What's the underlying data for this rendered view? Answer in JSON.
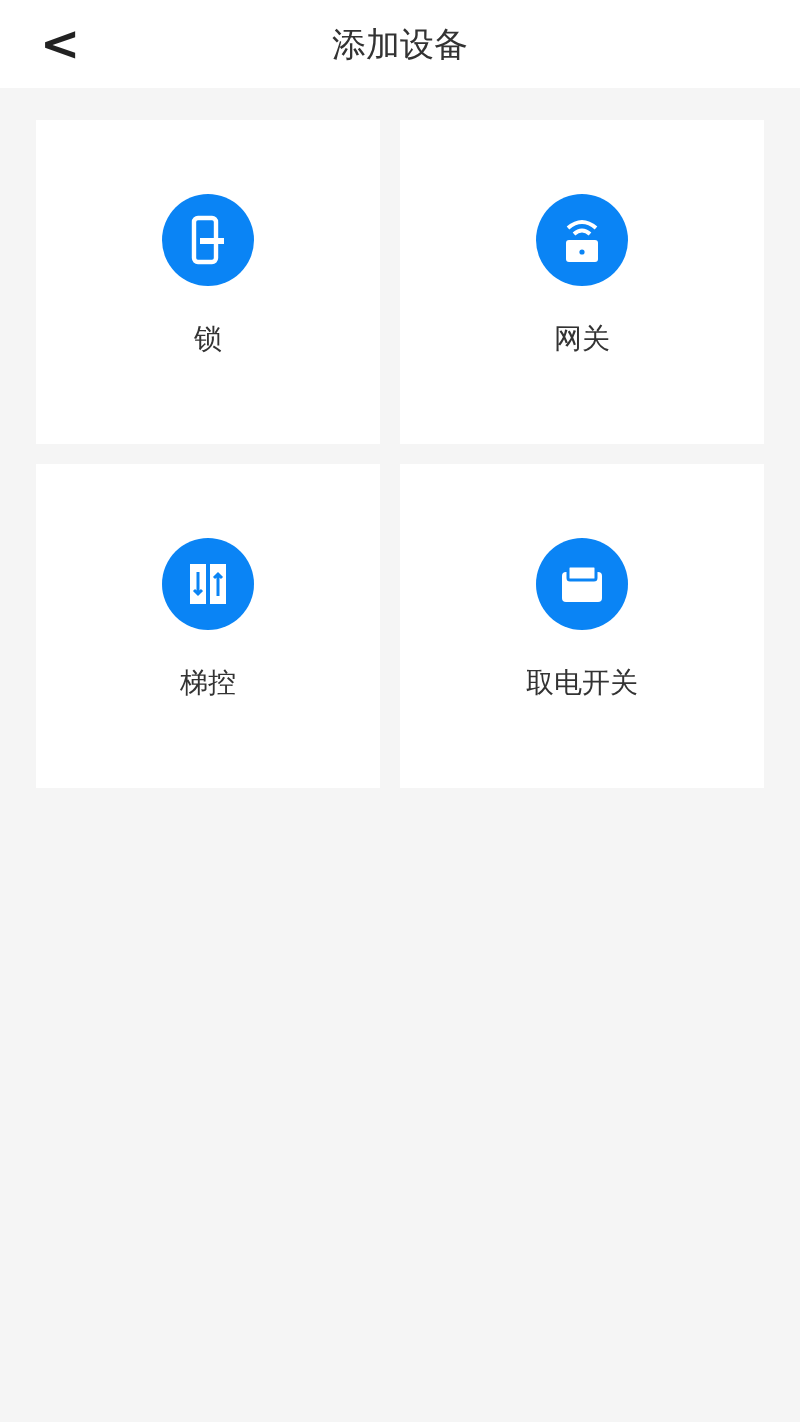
{
  "header": {
    "back": "<",
    "title": "添加设备"
  },
  "devices": [
    {
      "kind": "lock",
      "label": "锁"
    },
    {
      "kind": "gateway",
      "label": "网关"
    },
    {
      "kind": "elevator",
      "label": "梯控"
    },
    {
      "kind": "switch",
      "label": "取电开关"
    }
  ]
}
